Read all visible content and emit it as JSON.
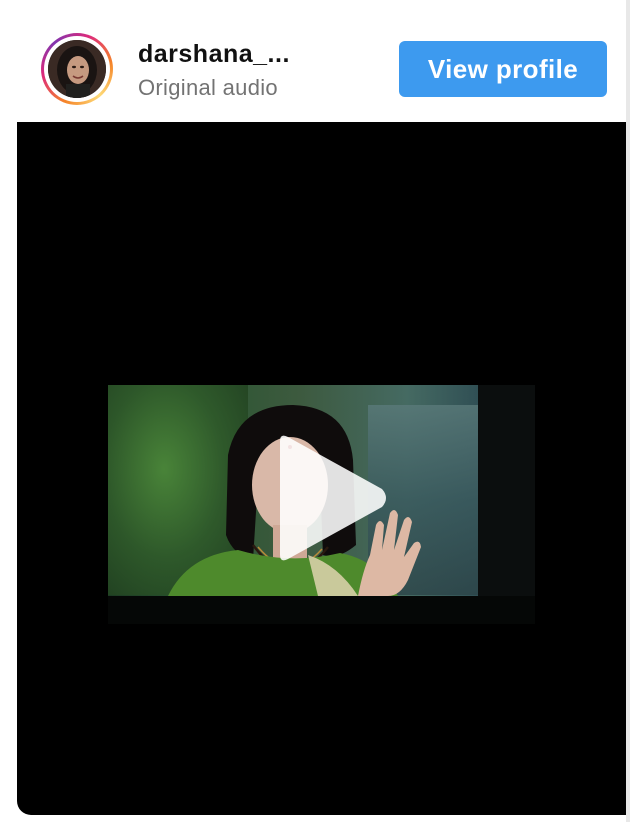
{
  "header": {
    "username": "darshana_...",
    "audio_label": "Original audio",
    "view_profile_label": "View profile"
  },
  "avatar": {
    "icon": "profile-photo",
    "ring_colors": [
      "#f58529",
      "#dd2a7b",
      "#8134af",
      "#feda77"
    ]
  },
  "video": {
    "background": "#000000",
    "play_icon": "play-icon"
  },
  "colors": {
    "button": "#3d9aef",
    "username": "#111111",
    "secondary_text": "#737373"
  }
}
